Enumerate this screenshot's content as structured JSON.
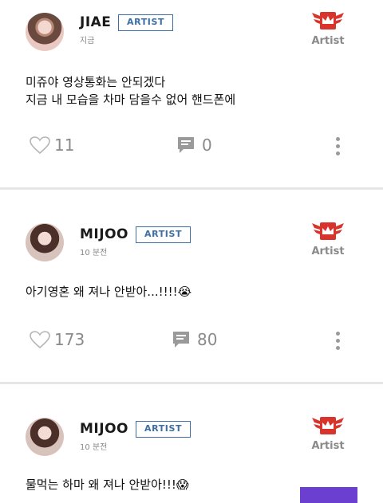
{
  "posts": [
    {
      "author": "JIAE",
      "badge": "ARTIST",
      "time": "지금",
      "artist_mark_label": "Artist",
      "content_lines": [
        "미쥬야 영상통화는 안되겠다",
        "지금 내 모습을 차마 담을수 없어 핸드폰에"
      ],
      "likes": "11",
      "comments": "0"
    },
    {
      "author": "MIJOO",
      "badge": "ARTIST",
      "time": "10 분전",
      "artist_mark_label": "Artist",
      "content_lines": [
        "아기영혼 왜 져나 안받아...!!!!😭"
      ],
      "likes": "173",
      "comments": "80"
    },
    {
      "author": "MIJOO",
      "badge": "ARTIST",
      "time": "10 분전",
      "artist_mark_label": "Artist",
      "content_lines": [
        "물먹는 하마 왜 져나 안받아!!!😱"
      ]
    }
  ],
  "colors": {
    "badge": "#3d6fa6",
    "artist_mark": "#d8342c",
    "icon_gray": "#9a9a9a"
  }
}
